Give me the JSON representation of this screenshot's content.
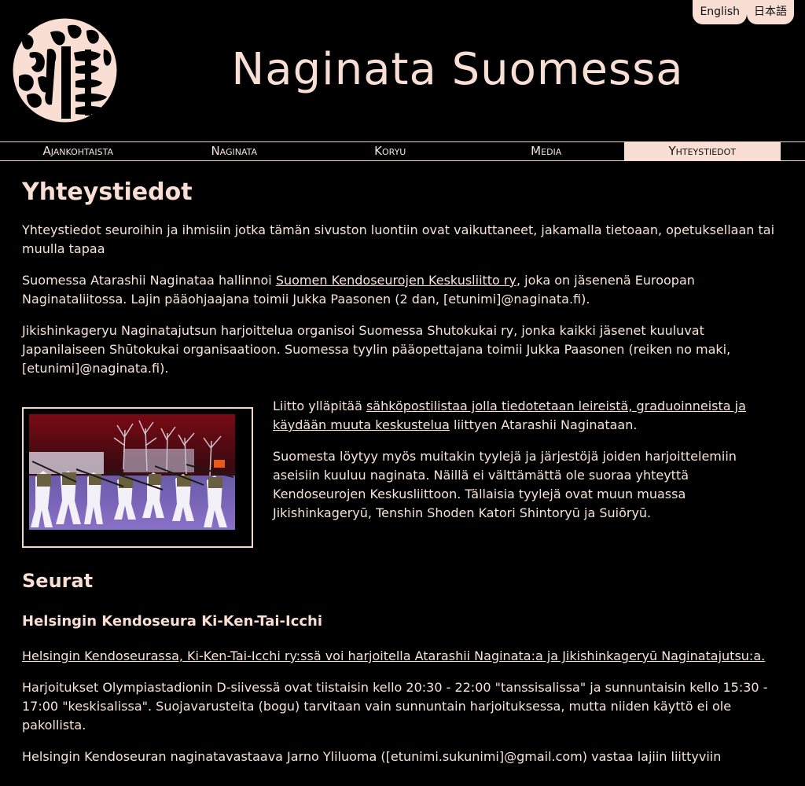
{
  "lang_switch": [
    "English",
    "日本語"
  ],
  "site_title": "Naginata Suomessa",
  "nav": [
    {
      "label": "Ajankohtaista",
      "active": false
    },
    {
      "label": "Naginata",
      "active": false
    },
    {
      "label": "Koryu",
      "active": false
    },
    {
      "label": "Media",
      "active": false
    },
    {
      "label": "Yhteystiedot",
      "active": true
    }
  ],
  "page": {
    "heading": "Yhteystiedot",
    "intro": "Yhteystiedot seuroihin ja ihmisiin jotka tämän sivuston luontiin ovat vaikuttaneet, jakamalla tietoaan, opetuksellaan tai muulla tapaa",
    "p2_before": "Suomessa Atarashii Naginataa hallinnoi ",
    "p2_link": "Suomen Kendoseurojen Keskusliitto ry",
    "p2_after": ", joka on jäsenenä Euroopan Naginataliitossa. Lajin pääohjaajana toimii Jukka Paasonen (2 dan, [etunimi]@naginata.fi).",
    "p3": "Jikishinkageryu Naginatajutsun harjoittelua organisoi Suomessa Shutokukai ry, jonka kaikki jäsenet kuuluvat Japanilaiseen Shūtokukai organisaatioon. Suomessa tyylin pääopettajana toimii Jukka Paasonen (reiken no maki, [etunimi]@naginata.fi).",
    "p4_before": "Liitto ylläpitää ",
    "p4_link": "sähköpostilistaa jolla tiedotetaan leireistä, graduoinneista ja käydään muuta keskustelua",
    "p4_after": " liittyen Atarashii Naginataan.",
    "p5": "Suomesta löytyy myös muitakin tyylejä ja järjestöjä joiden harjoittelemiin aseisiin kuuluu naginata. Näillä ei välttämättä ole suoraa yhteyttä Kendoseurojen Keskusliittoon. Tällaisia tyylejä ovat muun muassa Jikishinkageryū, Tenshin Shoden Katori Shintoryū ja Suiōryū."
  },
  "seurat": {
    "heading": "Seurat",
    "club_name": "Helsingin Kendoseura Ki-Ken-Tai-Icchi",
    "club_link": "Helsingin Kendoseurassa, Ki-Ken-Tai-Icchi ry:ssä voi harjoitella Atarashii Naginata:a ja Jikishinkageryū Naginatajutsu:a.",
    "club_schedule": "Harjoitukset Olympiastadionin D-siivessä ovat tiistaisin kello 20:30 - 22:00 \"tanssisalissa\" ja sunnuntaisin kello 15:30 - 17:00 \"keskisalissa\". Suojavarusteita (bogu) tarvitaan vain sunnuntain harjoituksessa, mutta niiden käyttö ei ole pakollista.",
    "club_contact": "Helsingin Kendoseuran naginatavastaava Jarno Yliluoma ([etunimi.sukunimi]@gmail.com) vastaa lajiin liittyviin"
  },
  "colors": {
    "background": "#000000",
    "accent": "#f8ded3"
  }
}
